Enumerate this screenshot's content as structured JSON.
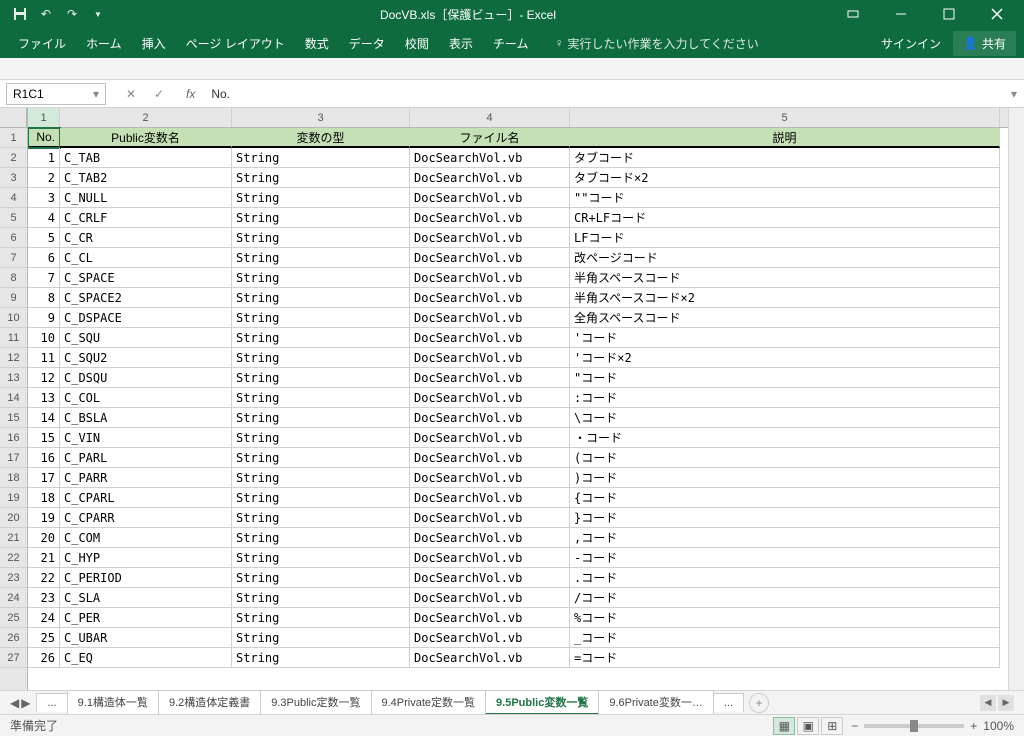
{
  "titlebar": {
    "title": "DocVB.xls［保護ビュー］- Excel"
  },
  "ribbon": {
    "tabs": [
      "ファイル",
      "ホーム",
      "挿入",
      "ページ レイアウト",
      "数式",
      "データ",
      "校閲",
      "表示",
      "チーム"
    ],
    "tell_me": "実行したい作業を入力してください",
    "signin": "サインイン",
    "share": "共有"
  },
  "formula_bar": {
    "name_box": "R1C1",
    "value": "No."
  },
  "col_headers": [
    "1",
    "2",
    "3",
    "4",
    "5"
  ],
  "table_headers": [
    "No.",
    "Public変数名",
    "変数の型",
    "ファイル名",
    "説明"
  ],
  "rows": [
    {
      "n": "1",
      "name": "C_TAB",
      "type": "String",
      "file": "DocSearchVol.vb",
      "desc": "タブコード"
    },
    {
      "n": "2",
      "name": "C_TAB2",
      "type": "String",
      "file": "DocSearchVol.vb",
      "desc": "タブコード×2"
    },
    {
      "n": "3",
      "name": "C_NULL",
      "type": "String",
      "file": "DocSearchVol.vb",
      "desc": "\"\"コード"
    },
    {
      "n": "4",
      "name": "C_CRLF",
      "type": "String",
      "file": "DocSearchVol.vb",
      "desc": "CR+LFコード"
    },
    {
      "n": "5",
      "name": "C_CR",
      "type": "String",
      "file": "DocSearchVol.vb",
      "desc": "LFコード"
    },
    {
      "n": "6",
      "name": "C_CL",
      "type": "String",
      "file": "DocSearchVol.vb",
      "desc": "改ページコード"
    },
    {
      "n": "7",
      "name": "C_SPACE",
      "type": "String",
      "file": "DocSearchVol.vb",
      "desc": "半角スペースコード"
    },
    {
      "n": "8",
      "name": "C_SPACE2",
      "type": "String",
      "file": "DocSearchVol.vb",
      "desc": "半角スペースコード×2"
    },
    {
      "n": "9",
      "name": "C_DSPACE",
      "type": "String",
      "file": "DocSearchVol.vb",
      "desc": "全角スペースコード"
    },
    {
      "n": "10",
      "name": "C_SQU",
      "type": "String",
      "file": "DocSearchVol.vb",
      "desc": "'コード"
    },
    {
      "n": "11",
      "name": "C_SQU2",
      "type": "String",
      "file": "DocSearchVol.vb",
      "desc": "'コード×2"
    },
    {
      "n": "12",
      "name": "C_DSQU",
      "type": "String",
      "file": "DocSearchVol.vb",
      "desc": "\"コード"
    },
    {
      "n": "13",
      "name": "C_COL",
      "type": "String",
      "file": "DocSearchVol.vb",
      "desc": ":コード"
    },
    {
      "n": "14",
      "name": "C_BSLA",
      "type": "String",
      "file": "DocSearchVol.vb",
      "desc": "\\コード"
    },
    {
      "n": "15",
      "name": "C_VIN",
      "type": "String",
      "file": "DocSearchVol.vb",
      "desc": "・コード"
    },
    {
      "n": "16",
      "name": "C_PARL",
      "type": "String",
      "file": "DocSearchVol.vb",
      "desc": "(コード"
    },
    {
      "n": "17",
      "name": "C_PARR",
      "type": "String",
      "file": "DocSearchVol.vb",
      "desc": ")コード"
    },
    {
      "n": "18",
      "name": "C_CPARL",
      "type": "String",
      "file": "DocSearchVol.vb",
      "desc": "{コード"
    },
    {
      "n": "19",
      "name": "C_CPARR",
      "type": "String",
      "file": "DocSearchVol.vb",
      "desc": "}コード"
    },
    {
      "n": "20",
      "name": "C_COM",
      "type": "String",
      "file": "DocSearchVol.vb",
      "desc": ",コード"
    },
    {
      "n": "21",
      "name": "C_HYP",
      "type": "String",
      "file": "DocSearchVol.vb",
      "desc": "-コード"
    },
    {
      "n": "22",
      "name": "C_PERIOD",
      "type": "String",
      "file": "DocSearchVol.vb",
      "desc": ".コード"
    },
    {
      "n": "23",
      "name": "C_SLA",
      "type": "String",
      "file": "DocSearchVol.vb",
      "desc": "/コード"
    },
    {
      "n": "24",
      "name": "C_PER",
      "type": "String",
      "file": "DocSearchVol.vb",
      "desc": "%コード"
    },
    {
      "n": "25",
      "name": "C_UBAR",
      "type": "String",
      "file": "DocSearchVol.vb",
      "desc": "_コード"
    },
    {
      "n": "26",
      "name": "C_EQ",
      "type": "String",
      "file": "DocSearchVol.vb",
      "desc": "=コード"
    }
  ],
  "sheet_tabs": {
    "ellipsis": "...",
    "tabs": [
      "9.1構造体一覧",
      "9.2構造体定義書",
      "9.3Public定数一覧",
      "9.4Private定数一覧",
      "9.5Public変数一覧",
      "9.6Private変数一…"
    ],
    "active_index": 4,
    "add": "+"
  },
  "status": {
    "ready": "準備完了",
    "zoom": "100%"
  }
}
